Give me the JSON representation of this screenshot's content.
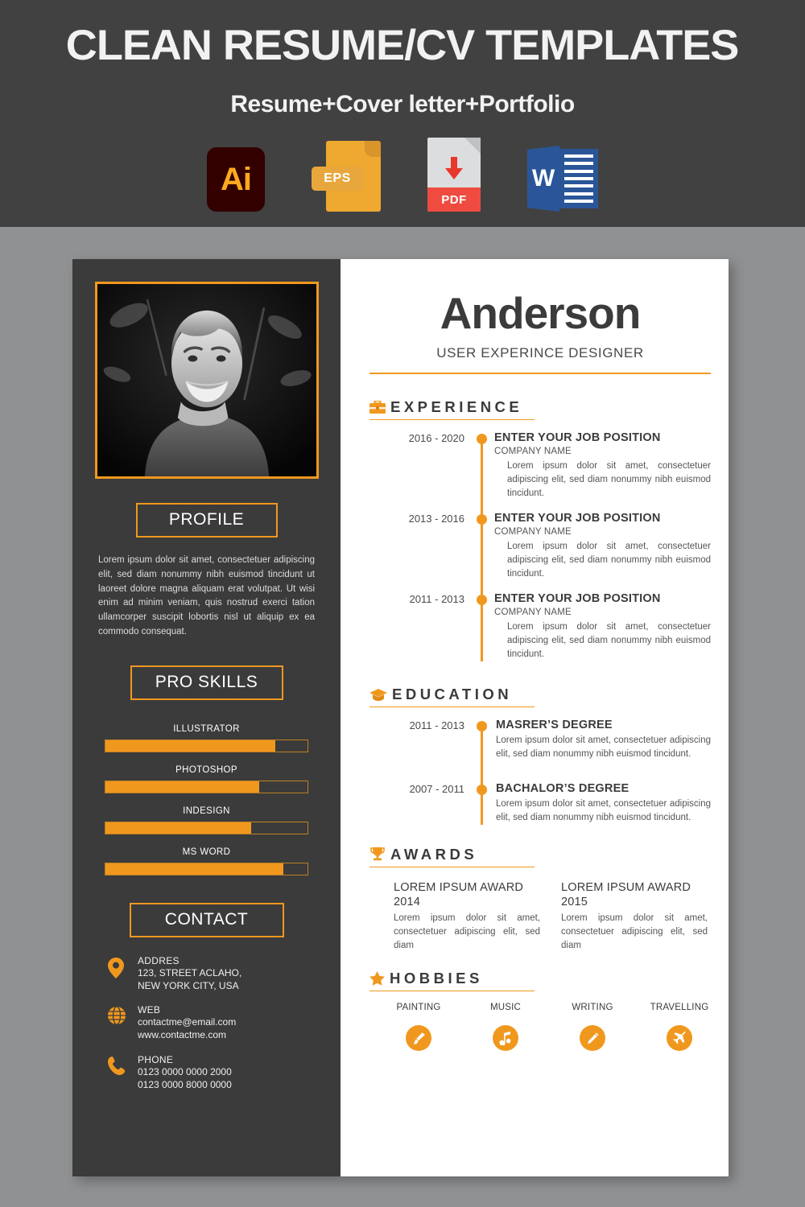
{
  "banner": {
    "title": "CLEAN RESUME/CV TEMPLATES",
    "subtitle": "Resume+Cover letter+Portfolio",
    "badges": [
      {
        "name": "illustrator-badge",
        "label": "Ai"
      },
      {
        "name": "eps-badge",
        "label": "EPS"
      },
      {
        "name": "pdf-badge",
        "label": "PDF"
      },
      {
        "name": "word-badge",
        "label": "W"
      }
    ]
  },
  "colors": {
    "accent": "#F0981E",
    "sidebar": "#3B3B3B",
    "banner": "#414141",
    "page_bg": "#909193",
    "paper": "#FFFFFF"
  },
  "resume": {
    "header": {
      "name": "Anderson",
      "role": "USER EXPERINCE DESIGNER"
    },
    "sidebar": {
      "photo_alt": "portrait-photo",
      "profile": {
        "heading": "PROFILE",
        "text": "Lorem ipsum dolor sit amet, consectetuer adipiscing elit, sed diam nonummy nibh euismod tincidunt ut laoreet dolore magna aliquam erat volutpat. Ut wisi enim ad minim veniam, quis nostrud exerci tation ullamcorper suscipit lobortis nisl ut aliquip ex ea commodo consequat."
      },
      "skills": {
        "heading": "PRO SKILLS",
        "items": [
          {
            "label": "ILLUSTRATOR",
            "value": 84
          },
          {
            "label": "PHOTOSHOP",
            "value": 76
          },
          {
            "label": "INDESIGN",
            "value": 72
          },
          {
            "label": "MS WORD",
            "value": 88
          }
        ]
      },
      "contact": {
        "heading": "CONTACT",
        "items": [
          {
            "icon": "location-pin-icon",
            "title": "ADDRES",
            "line1": "123, STREET ACLAHO,",
            "line2": "NEW YORK CITY, USA"
          },
          {
            "icon": "globe-icon",
            "title": "WEB",
            "line1": "contactme@email.com",
            "line2": "www.contactme.com"
          },
          {
            "icon": "phone-icon",
            "title": "PHONE",
            "line1": "0123 0000 0000 2000",
            "line2": "0123 0000 8000 0000"
          }
        ]
      }
    },
    "experience": {
      "heading": "EXPERIENCE",
      "icon": "briefcase-icon",
      "items": [
        {
          "date": "2016 - 2020",
          "position": "ENTER YOUR JOB POSITION",
          "company": "COMPANY NAME",
          "desc": "Lorem ipsum dolor sit amet, consectetuer adipiscing elit, sed diam nonummy nibh euismod tincidunt."
        },
        {
          "date": "2013 - 2016",
          "position": "ENTER YOUR JOB POSITION",
          "company": "COMPANY NAME",
          "desc": "Lorem ipsum dolor sit amet, consectetuer adipiscing elit, sed diam nonummy nibh euismod tincidunt."
        },
        {
          "date": "2011 - 2013",
          "position": "ENTER YOUR JOB POSITION",
          "company": "COMPANY NAME",
          "desc": "Lorem ipsum dolor sit amet, consectetuer adipiscing elit, sed diam nonummy nibh euismod tincidunt."
        }
      ]
    },
    "education": {
      "heading": "EDUCATION",
      "icon": "graduation-cap-icon",
      "items": [
        {
          "date": "2011 - 2013",
          "degree": "MASRER’S DEGREE",
          "desc": "Lorem ipsum dolor sit amet, consectetuer adipiscing elit, sed diam nonummy nibh euismod tincidunt."
        },
        {
          "date": "2007 - 2011",
          "degree": "BACHALOR’S DEGREE",
          "desc": "Lorem ipsum dolor sit amet, consectetuer adipiscing elit, sed diam nonummy nibh euismod tincidunt."
        }
      ]
    },
    "awards": {
      "heading": "AWARDS",
      "icon": "trophy-icon",
      "items": [
        {
          "title": "LOREM IPSUM AWARD 2014",
          "desc": "Lorem ipsum dolor sit amet, consectetuer adipiscing elit, sed diam"
        },
        {
          "title": "LOREM IPSUM AWARD 2015",
          "desc": "Lorem ipsum dolor sit amet, consectetuer adipiscing elit, sed diam"
        }
      ]
    },
    "hobbies": {
      "heading": "HOBBIES",
      "icon": "star-icon",
      "items": [
        {
          "label": "PAINTING",
          "icon": "paintbrush-icon"
        },
        {
          "label": "MUSIC",
          "icon": "music-note-icon"
        },
        {
          "label": "WRITING",
          "icon": "pencil-icon"
        },
        {
          "label": "TRAVELLING",
          "icon": "airplane-icon"
        }
      ]
    }
  }
}
